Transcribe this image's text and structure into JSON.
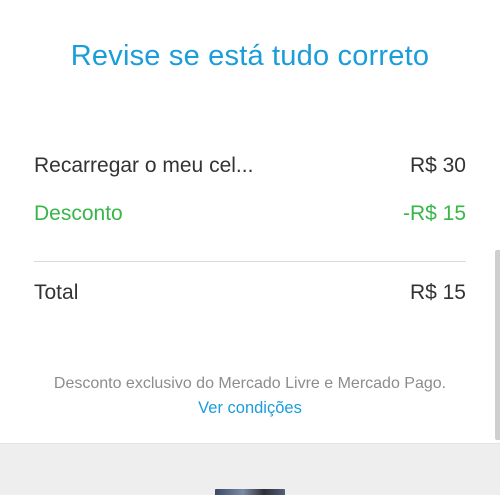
{
  "header": {
    "title": "Revise se está tudo correto"
  },
  "summary": {
    "item": {
      "label": "Recarregar o meu cel...",
      "value": "R$ 30"
    },
    "discount": {
      "label": "Desconto",
      "value": "-R$ 15",
      "color": "#39b54a"
    },
    "total": {
      "label": "Total",
      "value": "R$ 15"
    }
  },
  "disclaimer": {
    "text": "Desconto exclusivo do Mercado Livre e Mercado Pago.",
    "link_label": "Ver condições"
  },
  "colors": {
    "accent": "#1a9dd9",
    "text": "#333333",
    "muted": "#8c8c8c"
  }
}
